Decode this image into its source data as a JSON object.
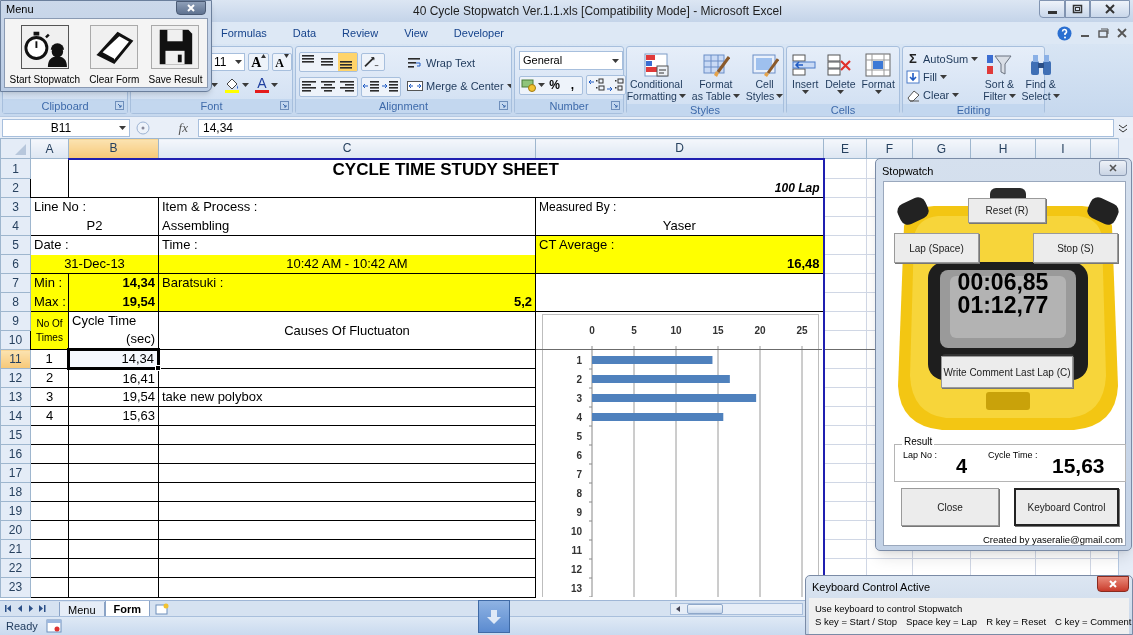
{
  "window": {
    "title": "40 Cycle Stopwatch Ver.1.1.xls  [Compatibility Mode] - Microsoft Excel"
  },
  "ribbon_tabs": [
    {
      "label": "Formulas",
      "selected": false
    },
    {
      "label": "Data",
      "selected": false
    },
    {
      "label": "Review",
      "selected": false
    },
    {
      "label": "View",
      "selected": false
    },
    {
      "label": "Developer",
      "selected": false
    }
  ],
  "ribbon": {
    "groups": [
      {
        "kind": "clipboard",
        "label": "Clipboard",
        "launcher": true
      },
      {
        "kind": "font",
        "label": "Font",
        "launcher": true,
        "size": "11",
        "grow": "A",
        "shrink": "A",
        "font_color_glyph": "A"
      },
      {
        "kind": "alignment",
        "label": "Alignment",
        "launcher": true,
        "vertical": [
          {
            "selected": false
          },
          {
            "selected": false
          },
          {
            "selected": true
          }
        ],
        "wrap": "Wrap Text",
        "merge": "Merge & Center"
      },
      {
        "kind": "number",
        "label": "Number",
        "launcher": true,
        "format": "General",
        "symbols": [
          "%",
          ","
        ]
      },
      {
        "kind": "buttons",
        "label": "Styles",
        "launcher": false,
        "buttons": [
          {
            "lines": [
              "Conditional",
              "Formatting"
            ],
            "dropdown": true
          },
          {
            "lines": [
              "Format",
              "as Table"
            ],
            "dropdown": true
          },
          {
            "lines": [
              "Cell",
              "Styles"
            ],
            "dropdown": true
          }
        ]
      },
      {
        "kind": "buttons",
        "label": "Cells",
        "launcher": false,
        "buttons": [
          {
            "lines": [
              "Insert"
            ],
            "dropdown": true
          },
          {
            "lines": [
              "Delete"
            ],
            "dropdown": true
          },
          {
            "lines": [
              "Format"
            ],
            "dropdown": true
          }
        ]
      },
      {
        "kind": "editing",
        "label": "Editing",
        "launcher": false,
        "small": [
          {
            "glyph": "Σ",
            "label": "AutoSum",
            "dropdown": true
          },
          {
            "label": "Fill",
            "dropdown": true
          },
          {
            "label": "Clear",
            "dropdown": true
          }
        ],
        "buttons": [
          {
            "lines": [
              "Sort &",
              "Filter"
            ],
            "dropdown": true
          },
          {
            "lines": [
              "Find &",
              "Select"
            ],
            "dropdown": true
          }
        ]
      }
    ]
  },
  "formula_bar": {
    "name_box": "B11",
    "function_button": "fx",
    "formula": "14,34"
  },
  "columns": [
    {
      "label": "A",
      "selected": false
    },
    {
      "label": "B",
      "selected": true
    },
    {
      "label": "C",
      "selected": false
    },
    {
      "label": "D",
      "selected": false
    },
    {
      "label": "E",
      "selected": false
    },
    {
      "label": "F",
      "selected": false
    },
    {
      "label": "G",
      "selected": false
    },
    {
      "label": "H",
      "selected": false
    },
    {
      "label": "I",
      "selected": false
    }
  ],
  "row_headers": [
    {
      "label": "1",
      "selected": false
    },
    {
      "label": "2",
      "selected": false
    },
    {
      "label": "3",
      "selected": false
    },
    {
      "label": "4",
      "selected": false
    },
    {
      "label": "5",
      "selected": false
    },
    {
      "label": "6",
      "selected": false
    },
    {
      "label": "7",
      "selected": false
    },
    {
      "label": "8",
      "selected": false
    },
    {
      "label": "9",
      "selected": false
    },
    {
      "label": "10",
      "selected": false
    },
    {
      "label": "11",
      "selected": true
    },
    {
      "label": "12",
      "selected": false
    },
    {
      "label": "13",
      "selected": false
    },
    {
      "label": "14",
      "selected": false
    },
    {
      "label": "15",
      "selected": false
    },
    {
      "label": "16",
      "selected": false
    },
    {
      "label": "17",
      "selected": false
    },
    {
      "label": "18",
      "selected": false
    },
    {
      "label": "19",
      "selected": false
    },
    {
      "label": "20",
      "selected": false
    },
    {
      "label": "21",
      "selected": false
    },
    {
      "label": "22",
      "selected": false
    },
    {
      "label": "23",
      "selected": false
    }
  ],
  "sheet": {
    "title": "CYCLE TIME STUDY SHEET",
    "subtitle": "100 Lap",
    "line_no_label": "Line No :",
    "line_no": "P2",
    "item_label": "Item & Process :",
    "item": "Assembling",
    "measured_label": "Measured By :",
    "measured_by": "Yaser",
    "date_label": "Date :",
    "date": "31-Dec-13",
    "time_label": "Time :",
    "time": "10:42 AM - 10:42 AM",
    "ct_average_label": "CT Average :",
    "ct_average": "16,48",
    "min_label": "Min :",
    "min": "14,34",
    "max_label": "Max :",
    "max": "19,54",
    "baratsuki_label": "Baratsuki :",
    "baratsuki": "5,2",
    "no_header": "No Of Times",
    "time_header": "Cycle Time",
    "time_unit": "(sec)",
    "cause_header": "Causes Of Fluctuaton",
    "records": [
      {
        "no": "1",
        "cycle_time": "14,34",
        "selected": true
      },
      {
        "no": "2",
        "cycle_time": "16,41",
        "selected": false
      },
      {
        "no": "3",
        "cycle_time": "19,54",
        "cause": "take new polybox",
        "selected": false
      },
      {
        "no": "4",
        "cycle_time": "15,63",
        "selected": false
      }
    ],
    "chart_data": {
      "type": "bar",
      "orientation": "horizontal",
      "categories": [
        "1",
        "2",
        "3",
        "4",
        "5",
        "6",
        "7",
        "8",
        "9",
        "10",
        "11",
        "12",
        "13"
      ],
      "values": [
        14.34,
        16.41,
        19.54,
        15.63,
        null,
        null,
        null,
        null,
        null,
        null,
        null,
        null,
        null
      ],
      "grid": true,
      "xlim": [
        0,
        25
      ],
      "xticks": [
        0,
        5,
        10,
        15,
        20,
        25
      ]
    }
  },
  "sheet_tabs": [
    {
      "label": "Menu",
      "selected": false
    },
    {
      "label": "Form",
      "selected": true
    }
  ],
  "status_bar": {
    "text": "Ready"
  },
  "menu_window": {
    "title": "Menu",
    "buttons": [
      {
        "label": "Start Stopwatch"
      },
      {
        "label": "Clear Form"
      },
      {
        "label": "Save Result"
      }
    ]
  },
  "stopwatch_window": {
    "title": "Stopwatch",
    "reset": "Reset (R)",
    "lap": "Lap (Space)",
    "stop": "Stop (S)",
    "display": [
      "00:06,85",
      "01:12,77"
    ],
    "comment": "Write Comment Last Lap (C)",
    "result": {
      "legend": "Result",
      "lap_label": "Lap No :",
      "lap": "4",
      "cycle_label": "Cycle Time :",
      "cycle": "15,63"
    },
    "actions": [
      {
        "label": "Close",
        "focused": false
      },
      {
        "label": "Keyboard Control",
        "focused": true
      }
    ],
    "credit": "Created by yaseralie@gmail.com"
  },
  "keyboard_window": {
    "title": "Keyboard Control Active",
    "intro": "Use keyboard to control Stopwatch",
    "keys": [
      "S key = Start / Stop",
      "Space key = Lap",
      "R key = Reset",
      "C key = Comment"
    ]
  }
}
